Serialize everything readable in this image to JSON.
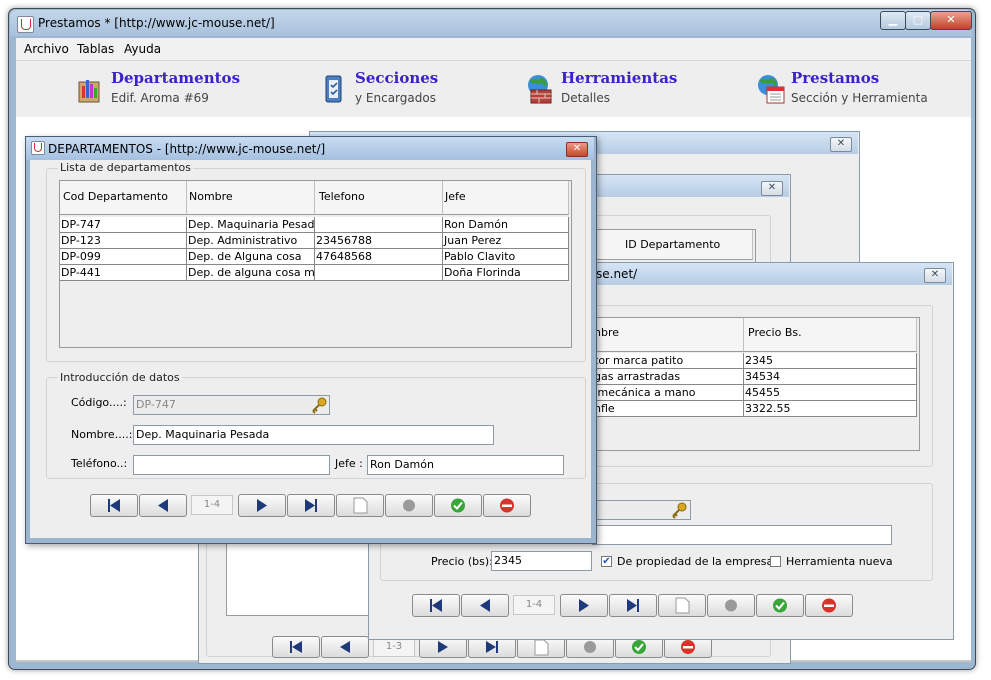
{
  "app": {
    "title": "Prestamos * [http://www.jc-mouse.net/]",
    "controls": [
      "▁",
      "□",
      "✕"
    ]
  },
  "menu": [
    "Archivo",
    "Tablas",
    "Ayuda"
  ],
  "toolbar": [
    {
      "title": "Departamentos",
      "subtitle": "Edif. Aroma #69"
    },
    {
      "title": "Secciones",
      "subtitle": "y Encargados"
    },
    {
      "title": "Herramientas",
      "subtitle": "Detalles"
    },
    {
      "title": "Prestamos",
      "subtitle": "Sección y Herramienta"
    }
  ],
  "colors": {
    "menu_title": "#3c21c9",
    "window_title_active": "#a5c0e0"
  },
  "departamentos": {
    "title": "DEPARTAMENTOS - [http://www.jc-mouse.net/]",
    "list_group": "Lista de departamentos",
    "columns": [
      "Cod Departamento",
      "Nombre",
      "Telefono",
      "Jefe"
    ],
    "rows": [
      [
        "DP-747",
        "Dep. Maquinaria Pesada",
        "",
        "Ron Damón"
      ],
      [
        "DP-123",
        "Dep. Administrativo",
        "23456788",
        "Juan Perez"
      ],
      [
        "DP-099",
        "Dep. de Alguna cosa",
        "47648568",
        "Pablo Clavito"
      ],
      [
        "DP-441",
        "Dep. de alguna cosa más",
        "",
        "Doña Florinda"
      ]
    ],
    "form_group": "Introducción de datos",
    "codigo_label": "Código....:",
    "codigo_value": "DP-747",
    "nombre_label": "Nombre....:",
    "nombre_value": "Dep. Maquinaria Pesada",
    "telefono_label": "Teléfono..:",
    "telefono_value": "",
    "jefe_label": "Jefe :",
    "jefe_value": "Ron Damón",
    "record_counter": "1-4"
  },
  "secciones": {
    "column": "ID Departamento",
    "record_counter": "1-3"
  },
  "herramientas": {
    "title_fragment": "se.net/",
    "columns": [
      "nbre",
      "Precio Bs."
    ],
    "rows": [
      [
        "tor marca patito",
        "2345"
      ],
      [
        "gas arrastradas",
        "34534"
      ],
      [
        " mecánica a mano",
        "45455"
      ],
      [
        "nfle",
        "3322.55"
      ]
    ],
    "precio_label": "Precio (bs):",
    "precio_value": "2345",
    "propiedad_label": "De propiedad de la empresa",
    "propiedad_checked": true,
    "nueva_label": "Herramienta nueva",
    "nueva_checked": false,
    "record_counter": "1-4"
  },
  "icons": {
    "first": "first-record-icon",
    "prev": "previous-record-icon",
    "next": "next-record-icon",
    "last": "last-record-icon",
    "new": "new-document-icon",
    "pending": "gray-dot-icon",
    "save": "green-check-icon",
    "delete": "red-minus-icon",
    "key": "key-icon"
  }
}
